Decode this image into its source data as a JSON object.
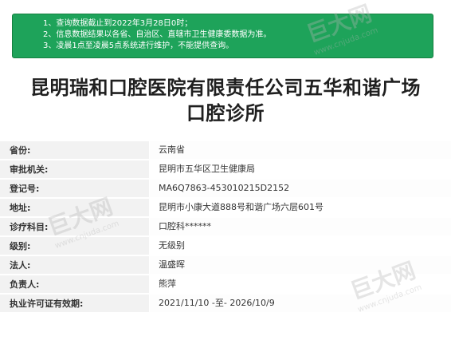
{
  "notice": {
    "lines": [
      "1、查询数据截止到2022年3月28日0时；",
      "2、信息数据结果以各省、自治区、直辖市卫生健康委数据为准。",
      "3、凌晨1点至凌晨5点系统进行维护，不能提供查询。"
    ]
  },
  "title": {
    "line1": "昆明瑞和口腔医院有限责任公司五华和谐广场",
    "line2": "口腔诊所"
  },
  "rows": [
    {
      "label": "省份:",
      "value": "云南省"
    },
    {
      "label": "审批机关:",
      "value": "昆明市五华区卫生健康局"
    },
    {
      "label": "登记号:",
      "value": "MA6Q7863-453010215D2152"
    },
    {
      "label": "地址:",
      "value": "昆明市小康大道888号和谐广场六层601号"
    },
    {
      "label": "诊疗科目:",
      "value": "口腔科******"
    },
    {
      "label": "级别:",
      "value": "无级别"
    },
    {
      "label": "法人:",
      "value": "温盛晖"
    },
    {
      "label": "负责人:",
      "value": "熊萍"
    },
    {
      "label": "执业许可证有效期:",
      "value": "2021/11/10 -至- 2026/10/9"
    }
  ],
  "watermark": {
    "brand": "巨大网",
    "url": "www.cnjuda.com"
  },
  "colors": {
    "notice_bg": "#1ea35a",
    "label_bg": "#f2f2f2"
  }
}
